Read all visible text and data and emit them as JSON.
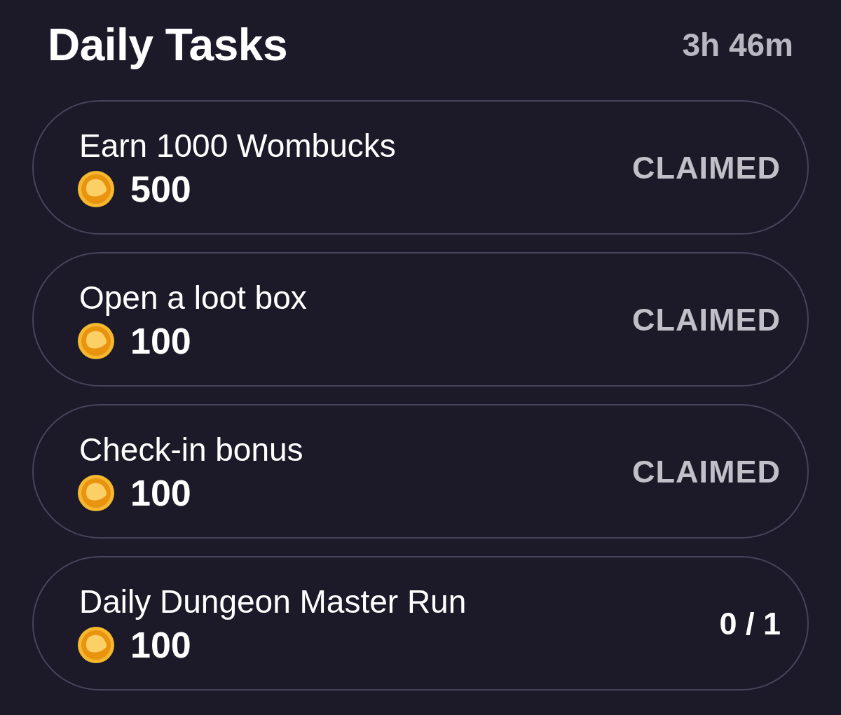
{
  "header": {
    "title": "Daily Tasks",
    "time_left": "3h 46m"
  },
  "tasks": [
    {
      "title": "Earn 1000 Wombucks",
      "reward": "500",
      "status": "CLAIMED",
      "claimed": true
    },
    {
      "title": "Open a loot box",
      "reward": "100",
      "status": "CLAIMED",
      "claimed": true
    },
    {
      "title": "Check-in bonus",
      "reward": "100",
      "status": "CLAIMED",
      "claimed": true
    },
    {
      "title": "Daily Dungeon Master Run",
      "reward": "100",
      "status": "0 / 1",
      "claimed": false
    }
  ]
}
